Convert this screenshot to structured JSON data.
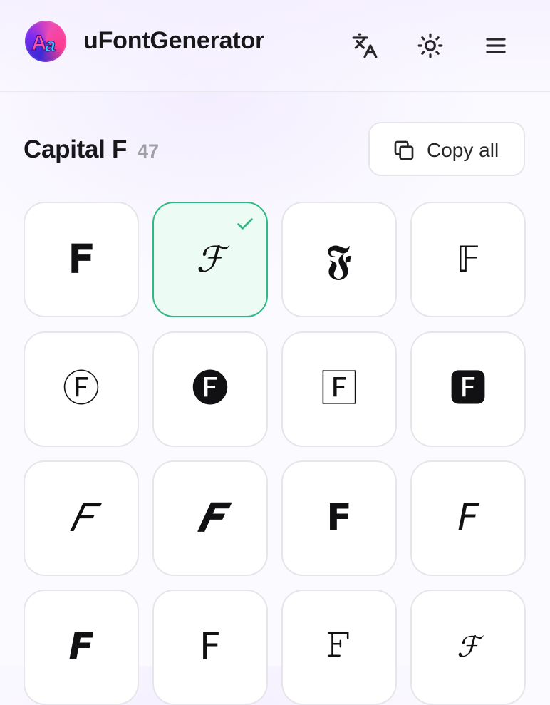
{
  "header": {
    "app_title": "uFontGenerator",
    "logo_text": "Aa",
    "icons": [
      "translate-icon",
      "sun-icon",
      "menu-icon"
    ]
  },
  "section": {
    "title": "Capital F",
    "count": "47",
    "copy_all_label": "Copy all"
  },
  "colors": {
    "selected_border": "#2eb884",
    "selected_bg": "#ecfbf3",
    "text": "#18181b",
    "muted": "#a1a1aa"
  },
  "glyphs": [
    {
      "char": "𝐅",
      "style": "serif-bold",
      "selected": false
    },
    {
      "char": "ℱ",
      "style": "script",
      "selected": true
    },
    {
      "char": "𝕱",
      "style": "fraktur-bold",
      "selected": false
    },
    {
      "char": "𝔽",
      "style": "double-struck",
      "selected": false
    },
    {
      "char": "Ⓕ",
      "style": "circled",
      "selected": false
    },
    {
      "char": "🅕",
      "style": "negative-circled",
      "selected": false
    },
    {
      "char": "🄵",
      "style": "squared",
      "selected": false
    },
    {
      "char": "🅵",
      "style": "negative-squared",
      "selected": false
    },
    {
      "char": "𝐹",
      "style": "serif-italic",
      "selected": false
    },
    {
      "char": "𝑭",
      "style": "serif-bold-italic",
      "selected": false
    },
    {
      "char": "𝗙",
      "style": "sans-bold",
      "selected": false
    },
    {
      "char": "𝘍",
      "style": "sans-italic",
      "selected": false
    },
    {
      "char": "𝙁",
      "style": "sans-bold-italic",
      "selected": false
    },
    {
      "char": "𝖥",
      "style": "sans",
      "selected": false
    },
    {
      "char": "𝙵",
      "style": "monospace",
      "selected": false
    },
    {
      "char": "ℱ",
      "style": "script-small",
      "selected": false
    }
  ]
}
